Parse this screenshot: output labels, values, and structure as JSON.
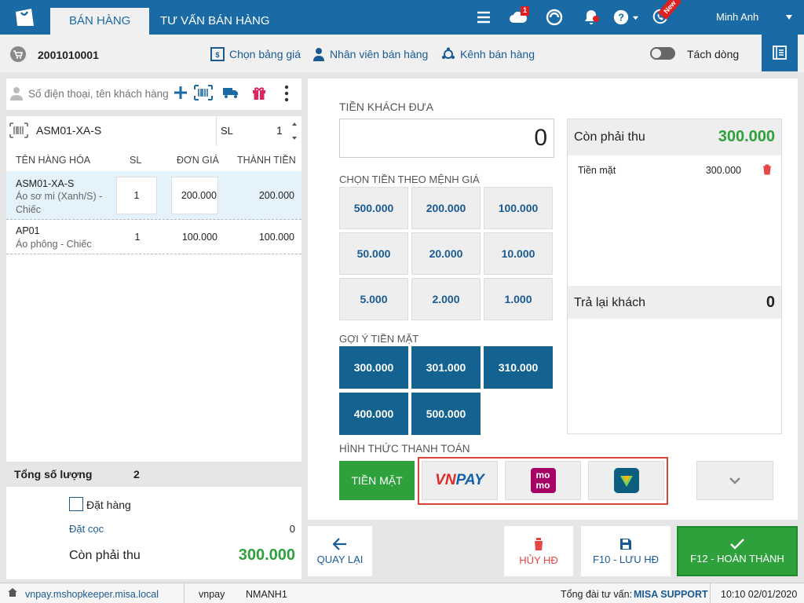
{
  "topbar": {
    "tabs": [
      "BÁN HÀNG",
      "TƯ VẤN BÁN HÀNG"
    ],
    "notif_count": "1",
    "new_badge": "New",
    "user": "Minh Anh"
  },
  "subbar": {
    "invoice_no": "2001010001",
    "price_list": "Chọn bảng giá",
    "salesperson": "Nhân viên bán hàng",
    "channel": "Kênh bán hàng",
    "split_line": "Tách dòng"
  },
  "customer": {
    "placeholder": "Số điện thoại, tên khách hàng"
  },
  "entry": {
    "code": "ASM01-XA-S",
    "sl_label": "SL",
    "sl_value": "1"
  },
  "table": {
    "headers": [
      "TÊN HÀNG HÓA",
      "SL",
      "ĐƠN GIÁ",
      "THÀNH TIỀN"
    ],
    "rows": [
      {
        "code": "ASM01-XA-S",
        "name": "Áo sơ mi (Xanh/S) -",
        "unit": "Chiếc",
        "qty": "1",
        "price": "200.000",
        "total": "200.000"
      },
      {
        "code": "AP01",
        "name": "Áo phông - Chiếc",
        "unit": "",
        "qty": "1",
        "price": "100.000",
        "total": "100.000"
      }
    ]
  },
  "summary": {
    "total_qty_label": "Tổng số lượng",
    "total_qty": "2",
    "order_label": "Đặt hàng",
    "deposit_label": "Đặt cọc",
    "deposit_value": "0",
    "remaining_label": "Còn phải thu",
    "remaining_value": "300.000"
  },
  "payment": {
    "given_label": "TIỀN KHÁCH ĐƯA",
    "given_value": "0",
    "denom_label": "CHỌN TIỀN THEO MỆNH GIÁ",
    "denoms": [
      "500.000",
      "200.000",
      "100.000",
      "50.000",
      "20.000",
      "10.000",
      "5.000",
      "2.000",
      "1.000"
    ],
    "suggest_label": "GỢI Ý TIỀN MẶT",
    "suggests": [
      "300.000",
      "301.000",
      "310.000",
      "400.000",
      "500.000"
    ],
    "method_label": "HÌNH THỨC THANH TOÁN",
    "cash_label": "TIỀN MẶT",
    "vnpay_vn": "VN",
    "vnpay_pay": "PAY",
    "momo_top": "mo",
    "momo_bottom": "mo",
    "remaining_label": "Còn phải thu",
    "remaining_value": "300.000",
    "cash_line_label": "Tiền mặt",
    "cash_line_value": "300.000",
    "change_label": "Trả lại khách",
    "change_value": "0"
  },
  "actions": {
    "back": "QUAY LẠI",
    "cancel": "HỦY HĐ",
    "save": "F10 - LƯU HĐ",
    "done": "F12 - HOÀN THÀNH"
  },
  "status": {
    "url": "vnpay.mshopkeeper.misa.local",
    "shop": "vnpay",
    "staff": "NMANH1",
    "hotline_label": "Tổng đài tư vấn:",
    "hotline": "MISA SUPPORT",
    "datetime": "10:10 02/01/2020"
  },
  "colors": {
    "primary": "#1a6aa5",
    "green": "#2ea13c",
    "dark_blue": "#13628f"
  }
}
